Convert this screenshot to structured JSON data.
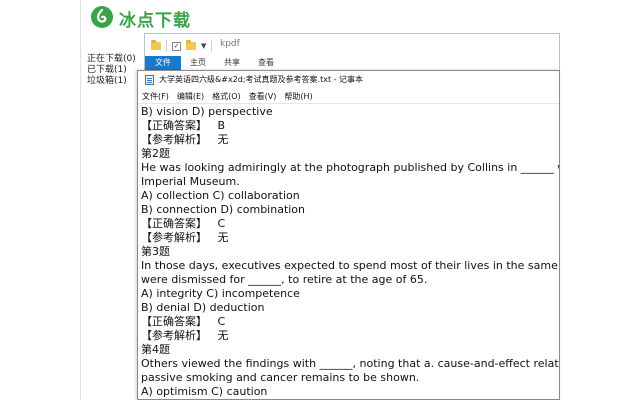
{
  "downloader": {
    "title": "冰点下载",
    "sidebar": {
      "items": [
        {
          "label": "正在下载(0)"
        },
        {
          "label": "已下载(1)"
        },
        {
          "label": "垃圾箱(1)"
        }
      ]
    }
  },
  "explorer": {
    "title": "kpdf",
    "ribbon_tabs": [
      "文件",
      "主页",
      "共享",
      "查看"
    ]
  },
  "notepad": {
    "title": "大学英语四六级&#x2d;考试真题及参考答案.txt - 记事本",
    "menu": [
      "文件(F)",
      "编辑(E)",
      "格式(O)",
      "查看(V)",
      "帮助(H)"
    ],
    "lines": [
      "B) vision D) perspective",
      "【正确答案】   B",
      "【参考解析】   无",
      "第2题",
      "He was looking admiringly at the photograph published by Collins in ______ with",
      "Imperial Museum.",
      "A) collection C) collaboration",
      "B) connection D) combination",
      "【正确答案】   C",
      "【参考解析】   无",
      "第3题",
      "In those days, executives expected to spend most of their lives in the same firm an",
      "were dismissed for ______, to retire at the age of 65.",
      "A) integrity C) incompetence",
      "B) denial D) deduction",
      "【正确答案】   C",
      "【参考解析】   无",
      "第4题",
      "Others viewed the findings with ______, noting that a. cause-and-effect relationsh",
      "passive smoking and cancer remains to be shown.",
      "A) optimism C) caution"
    ]
  },
  "colors": {
    "brand_green": "#3aa34a",
    "ribbon_file_blue": "#1979ca"
  },
  "icons": {
    "logo": "bingdian-logo-icon",
    "notepad": "notepad-icon",
    "folder": "folder-icon"
  }
}
